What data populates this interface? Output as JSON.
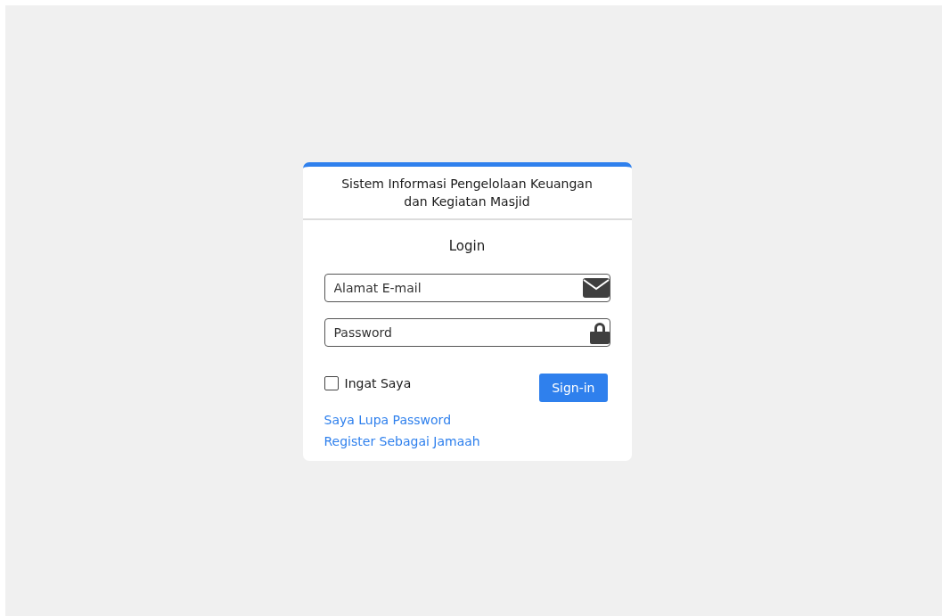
{
  "card": {
    "title": "Sistem Informasi Pengelolaan Keuangan dan Kegiatan Masjid",
    "heading": "Login"
  },
  "fields": [
    {
      "kind": "email",
      "placeholder": "Alamat E-mail"
    },
    {
      "kind": "password",
      "placeholder": "Password"
    }
  ],
  "remember": {
    "label": "Ingat Saya",
    "checked": false
  },
  "submit": {
    "label": "Sign-in"
  },
  "links": [
    "Saya Lupa Password",
    "Register Sebagai Jamaah"
  ]
}
